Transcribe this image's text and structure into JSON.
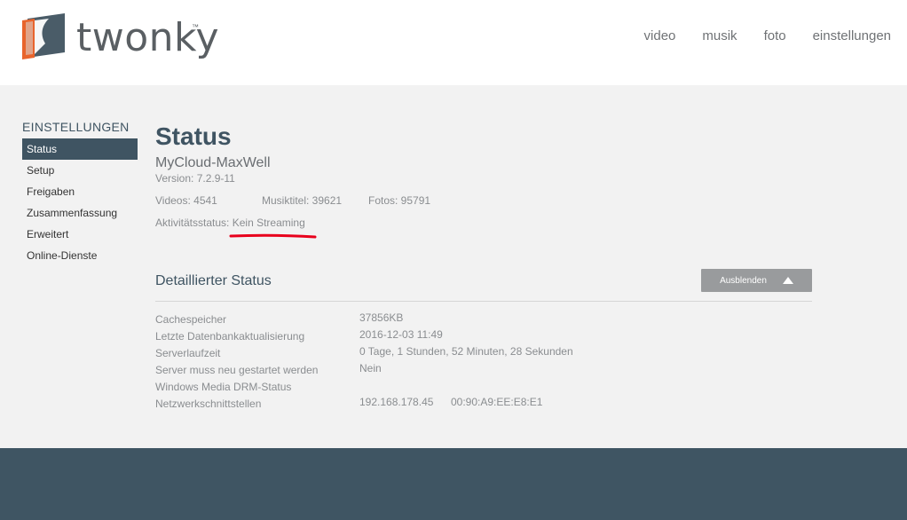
{
  "header": {
    "logo_text": "twonky",
    "logo_tm": "™",
    "nav": [
      "video",
      "musik",
      "foto",
      "einstellungen"
    ]
  },
  "sidebar": {
    "title": "EINSTELLUNGEN",
    "items": [
      {
        "label": "Status",
        "active": true
      },
      {
        "label": "Setup"
      },
      {
        "label": "Freigaben"
      },
      {
        "label": "Zusammenfassung"
      },
      {
        "label": "Erweitert"
      },
      {
        "label": "Online-Dienste"
      }
    ]
  },
  "status": {
    "title": "Status",
    "device_name": "MyCloud-MaxWell",
    "version": "Version: 7.2.9-11",
    "videos": "Videos: 4541",
    "music": "Musiktitel: 39621",
    "photos": "Fotos: 95791",
    "activity_label": "Aktivitätsstatus:",
    "activity_value": "Kein Streaming"
  },
  "detail": {
    "title": "Detaillierter Status",
    "hide_button": "Ausblenden",
    "rows": [
      {
        "label": "Cachespeicher",
        "value": "37856KB",
        "value2": ""
      },
      {
        "label": "Letzte Datenbankaktualisierung",
        "value": "2016-12-03 11:49",
        "value2": ""
      },
      {
        "label": "Serverlaufzeit",
        "value": "0 Tage, 1 Stunden, 52 Minuten, 28 Sekunden",
        "value2": ""
      },
      {
        "label": "Server muss neu gestartet werden",
        "value": "Nein",
        "value2": ""
      },
      {
        "label": "Windows Media DRM-Status",
        "value": "",
        "value2": ""
      },
      {
        "label": "Netzwerkschnittstellen",
        "value": "192.168.178.45",
        "value2": "00:90:A9:EE:E8:E1"
      }
    ]
  },
  "colors": {
    "brand": "#3f5462",
    "logo_orange": "#e8642c",
    "annotation": "#e8001c"
  }
}
